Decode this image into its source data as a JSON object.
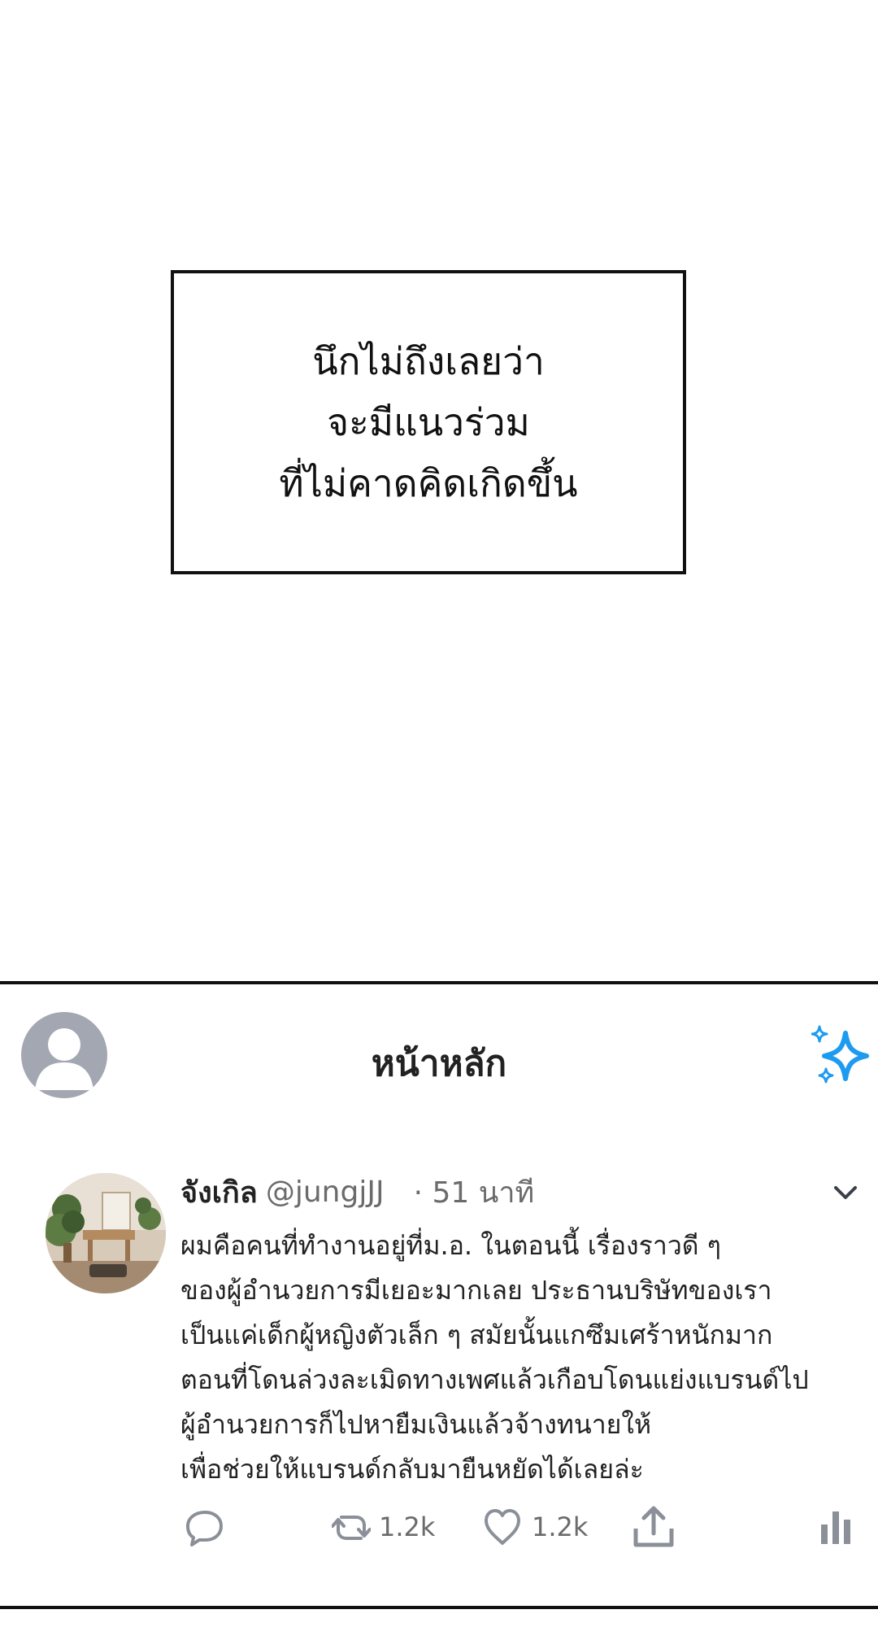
{
  "caption": {
    "lines": [
      "นึกไม่ถึงเลยว่า",
      "จะมีแนวร่วม",
      "ที่ไม่คาดคิดเกิดขึ้น"
    ]
  },
  "feed": {
    "header": {
      "title": "หน้าหลัก",
      "profile_icon": "default-profile-icon",
      "sparkle_icon": "sparkle-icon"
    },
    "tweet": {
      "name": "จังเกิล",
      "handle": "@jungjJJ",
      "time": "· 51 นาที",
      "text_lines": [
        "ผมคือคนที่ทำงานอยู่ที่ม.อ. ในตอนนี้ เรื่องราวดี ๆ",
        "ของผู้อำนวยการมีเยอะมากเลย ประธานบริษัทของเรา",
        "เป็นแค่เด็กผู้หญิงตัวเล็ก ๆ สมัยนั้นแกซึมเศร้าหนักมาก",
        "ตอนที่โดนล่วงละเมิดทางเพศแล้วเกือบโดนแย่งแบรนด์ไป",
        "ผู้อำนวยการก็ไปหายืมเงินแล้วจ้างทนายให้",
        "เพื่อช่วยให้แบรนด์กลับมายืนหยัดได้เลยล่ะ"
      ],
      "actions": {
        "reply_count": "",
        "retweet_count": "1.2k",
        "like_count": "1.2k"
      }
    }
  },
  "colors": {
    "accent": "#1d9bf0",
    "text": "#222222",
    "muted": "#6b6b6b",
    "avatar_placeholder": "#a3a7b2"
  }
}
